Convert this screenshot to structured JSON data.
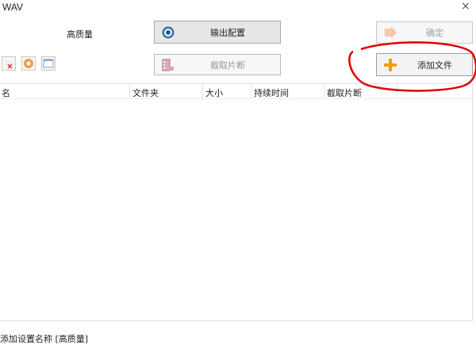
{
  "window": {
    "title": "WAV",
    "close_glyph": "×"
  },
  "preset_name": "高质量",
  "buttons": {
    "output_config": "输出配置",
    "clip": "截取片断",
    "ok": "确定",
    "add_file": "添加文件"
  },
  "small_buttons": [
    "delete-icon",
    "play-icon",
    "window-icon"
  ],
  "table": {
    "columns": [
      "名",
      "文件夹",
      "大小",
      "持续时间",
      "截取片断"
    ],
    "rows": []
  },
  "status": "添加设置名称 [高质量]",
  "colors": {
    "annotation_red": "#e00000",
    "add_icon": "#f39c12"
  }
}
